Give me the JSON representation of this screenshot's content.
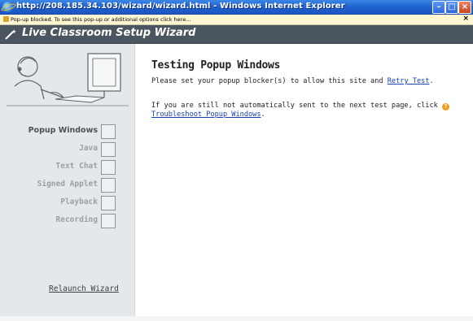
{
  "window": {
    "title": "http://208.185.34.103/wizard/wizard.html - Windows Internet Explorer",
    "buttons": {
      "minimize": "–",
      "maximize": "□",
      "close": "×"
    }
  },
  "infobar": {
    "text": "Pop-up blocked. To see this pop-up or additional options click here...",
    "close": "×"
  },
  "wizard": {
    "title": "Live Classroom Setup Wizard"
  },
  "sidebar": {
    "steps": [
      {
        "label": "Popup Windows",
        "active": true
      },
      {
        "label": "Java",
        "active": false
      },
      {
        "label": "Text Chat",
        "active": false
      },
      {
        "label": "Signed Applet",
        "active": false
      },
      {
        "label": "Playback",
        "active": false
      },
      {
        "label": "Recording",
        "active": false
      }
    ],
    "relaunch": "Relaunch Wizard"
  },
  "main": {
    "title": "Testing Popup Windows",
    "para1_text": "Please set your popup blocker(s) to allow this site and ",
    "para1_link": "Retry Test",
    "para1_end": ".",
    "para2_text": "If you are still not automatically sent to the next test page, click ",
    "para2_link": "Troubleshoot Popup Windows",
    "para2_end": "."
  },
  "colors": {
    "titlebar": "#1f5fcc",
    "wizard_header": "#4a5560",
    "sidebar": "#e4e8ea",
    "link": "#1a3fb0"
  }
}
